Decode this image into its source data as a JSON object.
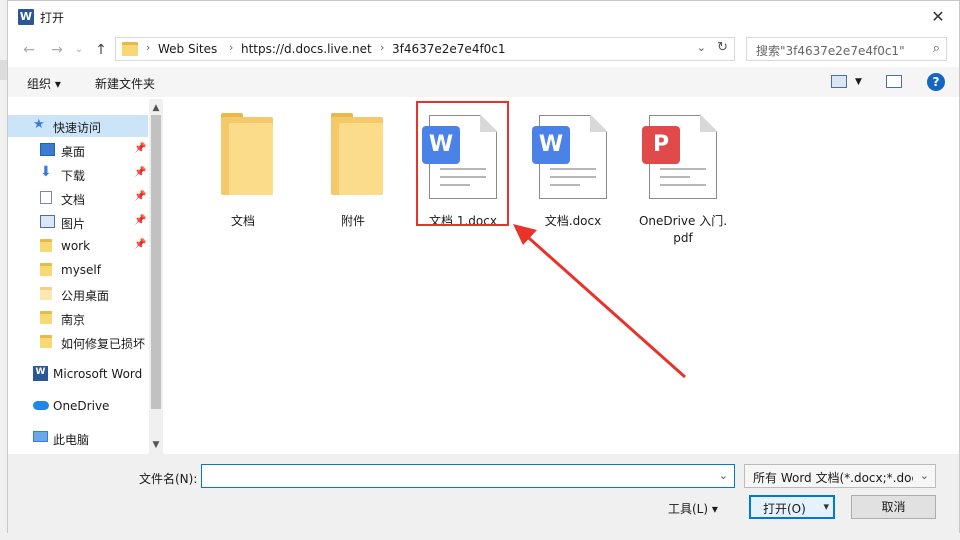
{
  "window": {
    "title": "打开",
    "app_icon": "W"
  },
  "address": {
    "crumbs": [
      "Web Sites",
      "https://d.docs.live.net",
      "3f4637e2e7e4f0c1"
    ]
  },
  "search": {
    "placeholder": "搜索\"3f4637e2e7e4f0c1\""
  },
  "toolbar": {
    "organize": "组织 ▾",
    "new_folder": "新建文件夹"
  },
  "sidebar": {
    "items": [
      {
        "label": "快速访问",
        "icon": "star-icon",
        "pinned": false
      },
      {
        "label": "桌面",
        "icon": "desktop-icon",
        "pinned": true
      },
      {
        "label": "下载",
        "icon": "download-icon",
        "pinned": true
      },
      {
        "label": "文档",
        "icon": "documents-icon",
        "pinned": true
      },
      {
        "label": "图片",
        "icon": "pictures-icon",
        "pinned": true
      },
      {
        "label": "work",
        "icon": "folder-icon",
        "pinned": true
      },
      {
        "label": "myself",
        "icon": "folder-icon",
        "pinned": false
      },
      {
        "label": "公用桌面",
        "icon": "folder-icon",
        "pinned": false
      },
      {
        "label": "南京",
        "icon": "folder-icon",
        "pinned": false
      },
      {
        "label": "如何修复已损坏",
        "icon": "folder-icon",
        "pinned": false
      },
      {
        "label": "Microsoft Word",
        "icon": "word-icon",
        "pinned": false
      },
      {
        "label": "OneDrive",
        "icon": "onedrive-icon",
        "pinned": false
      },
      {
        "label": "此电脑",
        "icon": "computer-icon",
        "pinned": false
      }
    ]
  },
  "files": [
    {
      "label": "文档",
      "type": "folder"
    },
    {
      "label": "附件",
      "type": "folder"
    },
    {
      "label": "文档 1.docx",
      "type": "docx",
      "highlighted": true
    },
    {
      "label": "文档.docx",
      "type": "docx"
    },
    {
      "label": "OneDrive 入门.\npdf",
      "type": "pdf"
    }
  ],
  "bottom": {
    "filename_label": "文件名(N):",
    "filename_value": "",
    "filetype": "所有 Word 文档(*.docx;*.doc",
    "tools": "工具(L)  ▾",
    "open": "打开(O)",
    "cancel": "取消"
  },
  "colors": {
    "highlight": "#e8322a",
    "accent": "#0078d7",
    "word_blue": "#4a82e8",
    "pdf_red": "#e04a4a"
  }
}
